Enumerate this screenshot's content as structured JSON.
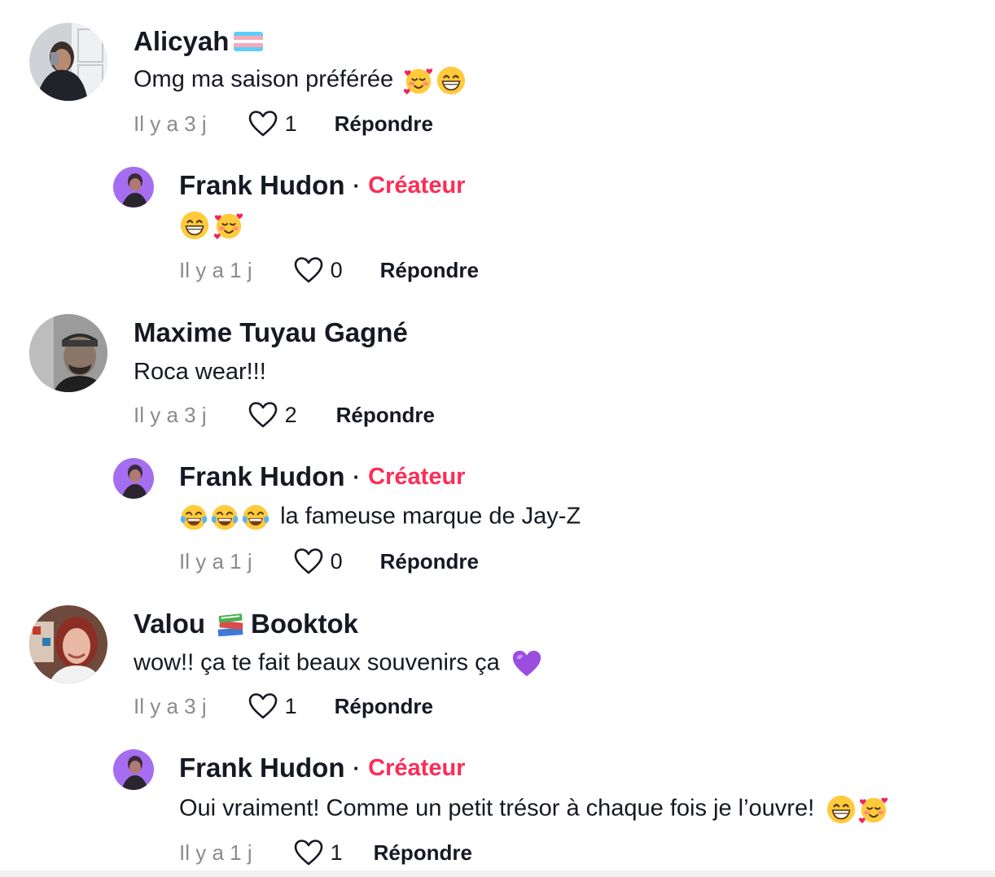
{
  "comments": [
    {
      "author": "Alicyah",
      "text": "Omg ma saison préférée",
      "time": "Il y a 3 j",
      "likes": "1",
      "reply_label": "Répondre"
    },
    {
      "author": "Frank Hudon",
      "badge": "Créateur",
      "text": "",
      "time": "Il y a 1 j",
      "likes": "0",
      "reply_label": "Répondre"
    },
    {
      "author": "Maxime Tuyau Gagné",
      "text": "Roca wear!!!",
      "time": "Il y a 3 j",
      "likes": "2",
      "reply_label": "Répondre"
    },
    {
      "author": "Frank Hudon",
      "badge": "Créateur",
      "text": "la fameuse marque de Jay-Z",
      "time": "Il y a 1 j",
      "likes": "0",
      "reply_label": "Répondre"
    },
    {
      "author_prefix": "Valou",
      "author_suffix": "Booktok",
      "text": "wow!! ça te fait beaux souvenirs ça",
      "time": "Il y a 3 j",
      "likes": "1",
      "reply_label": "Répondre"
    },
    {
      "author": "Frank Hudon",
      "badge": "Créateur",
      "text": "Oui vraiment! Comme un petit trésor à chaque fois je l’ouvre!",
      "time": "Il y a 1 j",
      "likes": "1",
      "reply_label": "Répondre"
    }
  ],
  "icons": {
    "like": "heart-outline-icon",
    "smiling_hearts": "smiling-face-with-hearts-emoji",
    "grin": "beaming-face-emoji",
    "tears_of_joy": "face-with-tears-of-joy-emoji",
    "purple_heart": "purple-heart-emoji",
    "books": "books-emoji",
    "trans_flag": "transgender-flag-emoji"
  },
  "colors": {
    "creator_badge": "#fe2c55",
    "time_text": "#8a8b91",
    "primary_text": "#161823"
  }
}
